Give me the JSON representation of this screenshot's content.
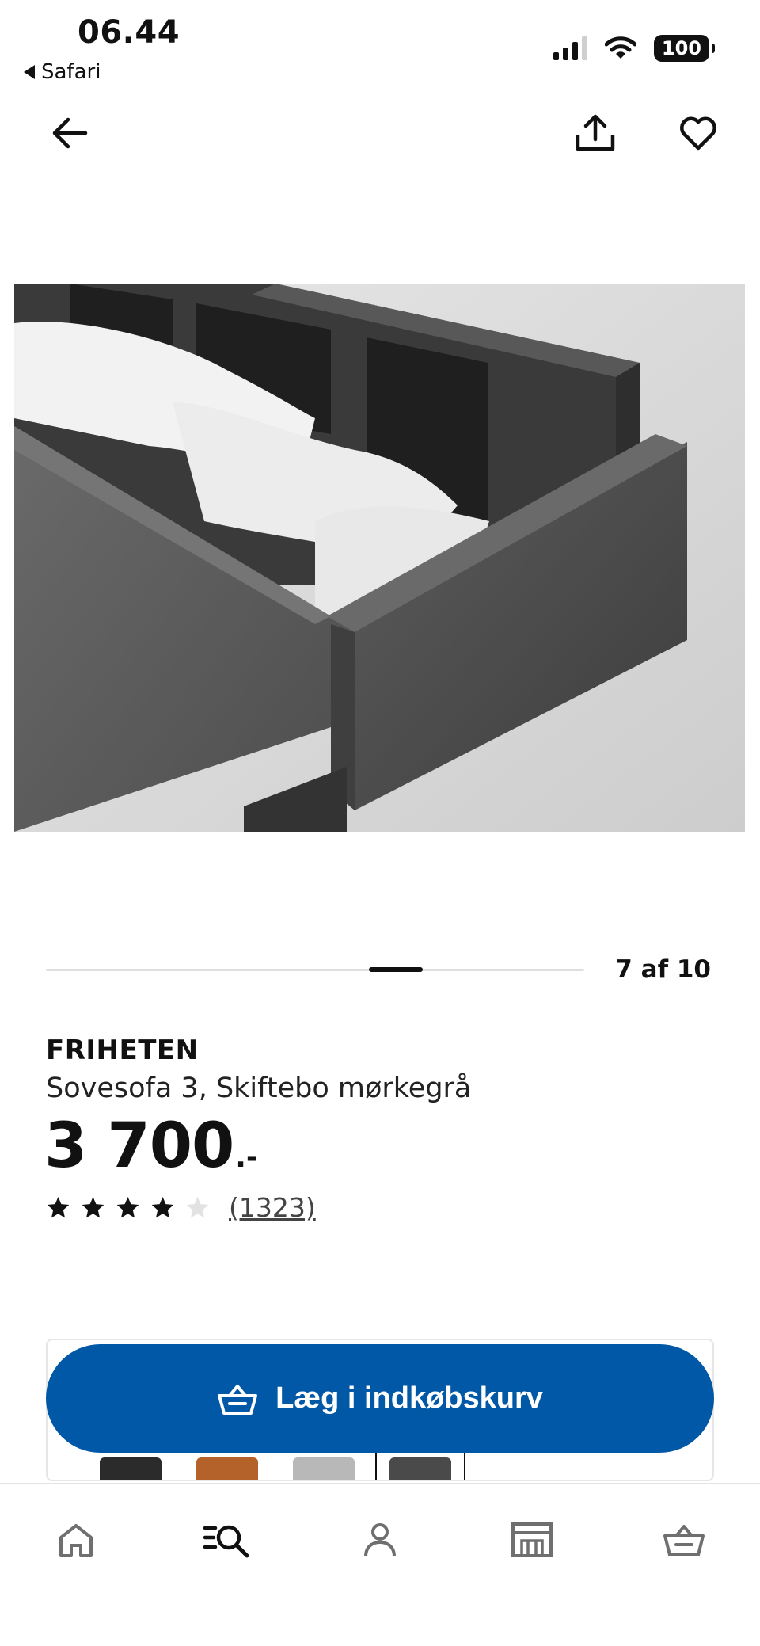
{
  "status_bar": {
    "time": "06.44",
    "back_app": "Safari",
    "battery": "100"
  },
  "app_bar": {
    "back_icon": "arrow-left-icon",
    "share_icon": "share-icon",
    "favorite_icon": "heart-icon"
  },
  "carousel": {
    "counter": "7 af 10",
    "current": 7,
    "total": 10
  },
  "product": {
    "brand": "FRIHETEN",
    "description": "Sovesofa 3, Skiftebo mørkegrå",
    "price_integer": "3 700",
    "price_decimal": ".-",
    "rating": 4,
    "rating_max": 5,
    "review_count": "(1323)"
  },
  "cart_button": {
    "label": "Læg i indkøbskurv",
    "color": "#0158a6"
  },
  "variants": {
    "colors": [
      "#2b2b2b",
      "#b5622a",
      "#b8b8b8",
      "#4a4a4a"
    ],
    "selected_index": 3
  },
  "bottom_nav": {
    "items": [
      "home-icon",
      "search-list-icon",
      "profile-icon",
      "store-icon",
      "cart-icon"
    ],
    "active_index": 1
  }
}
